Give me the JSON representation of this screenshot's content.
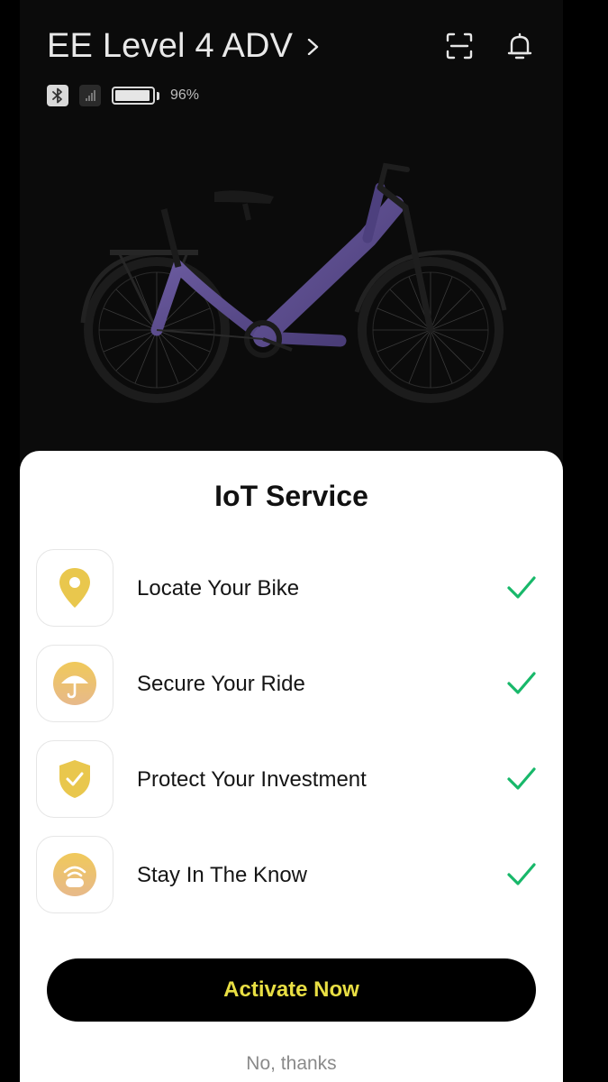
{
  "header": {
    "bike_name": "EE Level 4 ADV",
    "battery_percent": "96%",
    "battery_level": 0.96
  },
  "icons": {
    "bike_name_chevron": "chevron-right-icon",
    "scan": "scan-icon",
    "notifications": "bell-icon",
    "bluetooth": "bluetooth-icon",
    "signal": "signal-icon",
    "battery": "battery-icon"
  },
  "sheet": {
    "title": "IoT Service",
    "features": [
      {
        "label": "Locate Your Bike",
        "icon": "location-pin-icon",
        "checked": true
      },
      {
        "label": "Secure Your Ride",
        "icon": "umbrella-icon",
        "checked": true
      },
      {
        "label": "Protect Your Investment",
        "icon": "shield-check-icon",
        "checked": true
      },
      {
        "label": "Stay In The Know",
        "icon": "notification-icon",
        "checked": true
      }
    ],
    "primary_button": "Activate Now",
    "secondary_link": "No, thanks"
  },
  "colors": {
    "accent_yellow": "#e8de43",
    "icon_gold": "#e9c74d",
    "check_green": "#18b86a",
    "bike_purple": "#5a4a8c"
  }
}
